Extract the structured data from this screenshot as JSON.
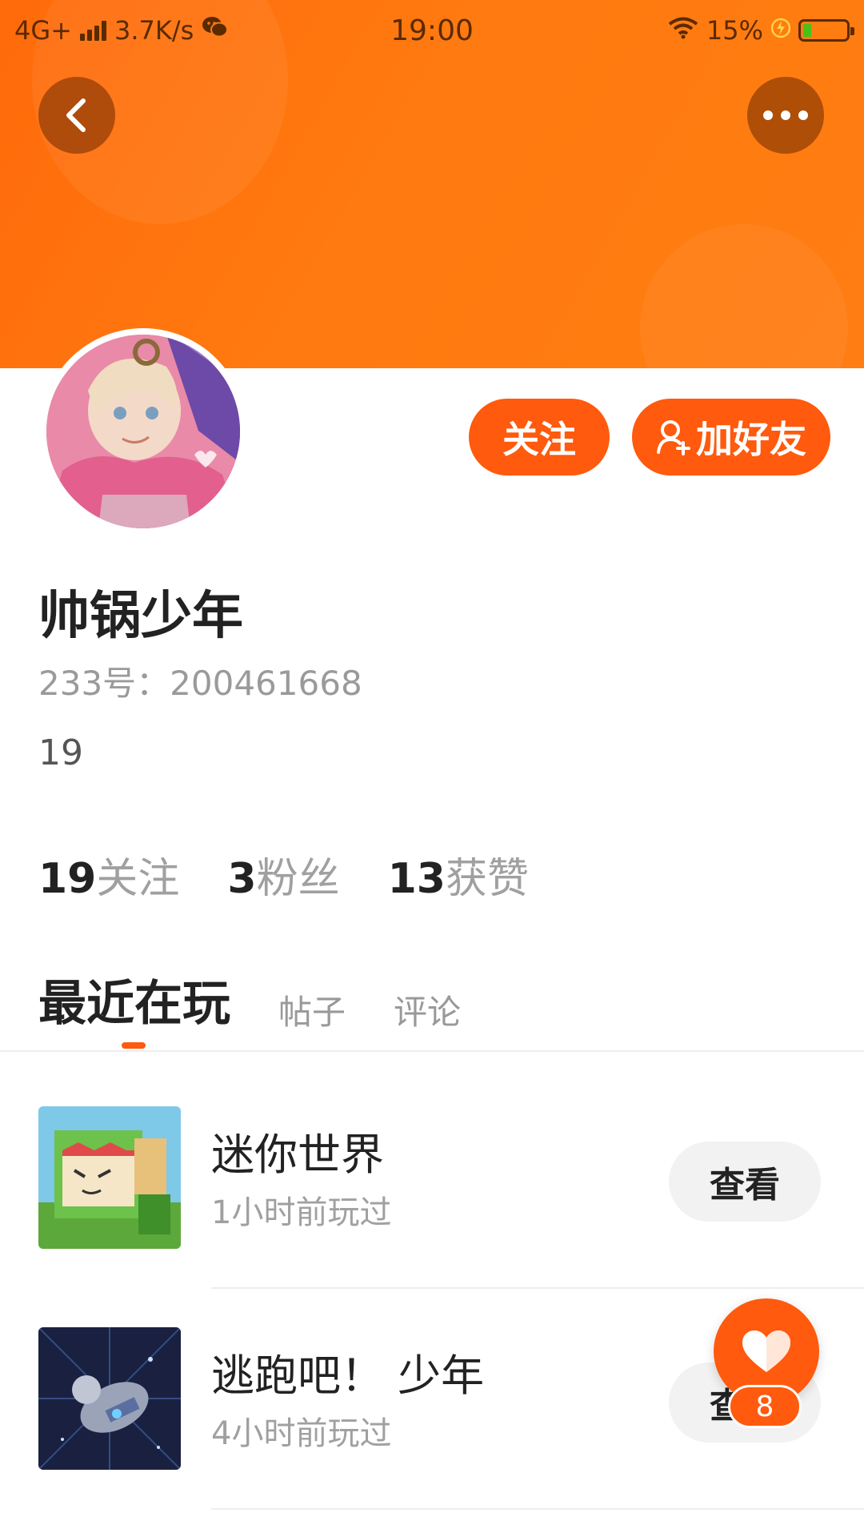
{
  "status_bar": {
    "network": "4G+",
    "speed": "3.7K/s",
    "time": "19:00",
    "battery": "15%",
    "battery_level": 0.15,
    "icons": [
      "signal-icon",
      "wechat-icon",
      "wifi-icon",
      "charging-icon",
      "battery-icon"
    ]
  },
  "header": {
    "back_icon": "chevron-left-icon",
    "more_icon": "more-horizontal-icon"
  },
  "profile": {
    "nickname": "帅锅少年",
    "uid": "233号：200461668",
    "bio": "19",
    "actions": {
      "follow_label": "关注",
      "add_friend_label": "加好友",
      "add_friend_icon": "user-plus-icon"
    },
    "stats": [
      {
        "num": "19",
        "label": "关注"
      },
      {
        "num": "3",
        "label": "粉丝"
      },
      {
        "num": "13",
        "label": "获赞"
      }
    ]
  },
  "tabs": [
    {
      "label": "最近在玩",
      "active": true
    },
    {
      "label": "帖子",
      "active": false
    },
    {
      "label": "评论",
      "active": false
    }
  ],
  "games": [
    {
      "title": "迷你世界",
      "meta": "1小时前玩过",
      "button": "查看"
    },
    {
      "title": "逃跑吧！ 少年",
      "meta": "4小时前玩过",
      "button": "查看"
    }
  ],
  "like_fab": {
    "icon": "heart-icon",
    "count": "8"
  },
  "colors": {
    "accent": "#ff5a0d",
    "banner": "#ff7a10"
  }
}
